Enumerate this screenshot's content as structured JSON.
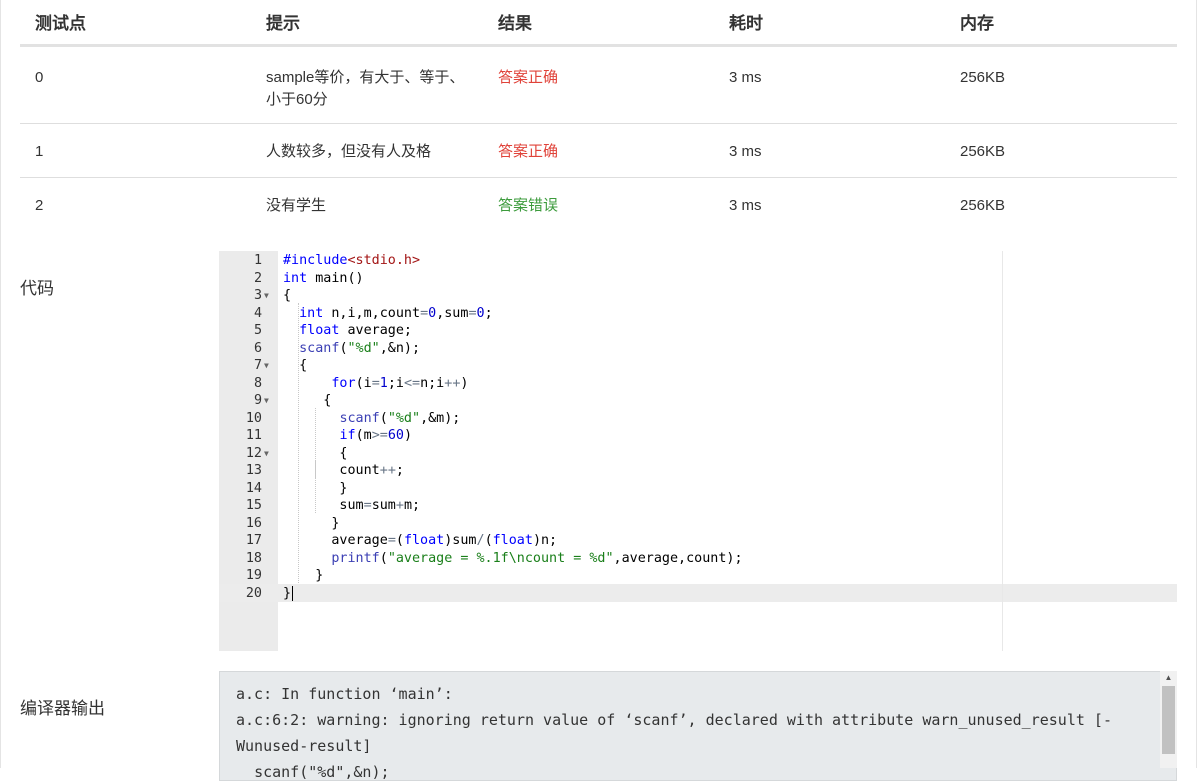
{
  "table": {
    "headers": {
      "case": "测试点",
      "hint": "提示",
      "result": "结果",
      "time": "耗时",
      "memory": "内存"
    },
    "rows": [
      {
        "case": "0",
        "hint": "sample等价，有大于、等于、小于60分",
        "result": "答案正确",
        "status": "correct",
        "time": "3 ms",
        "memory": "256KB"
      },
      {
        "case": "1",
        "hint": "人数较多，但没有人及格",
        "result": "答案正确",
        "status": "correct",
        "time": "3 ms",
        "memory": "256KB"
      },
      {
        "case": "2",
        "hint": "没有学生",
        "result": "答案错误",
        "status": "wrong",
        "time": "3 ms",
        "memory": "256KB"
      }
    ]
  },
  "code_section": {
    "label": "代码",
    "language": "c",
    "active_line": 20,
    "lines": [
      "#include<stdio.h>",
      "int main()",
      "{",
      "  int n,i,m,count=0,sum=0;",
      "  float average;",
      "  scanf(\"%d\",&n);",
      "  {",
      "      for(i=1;i<=n;i++)",
      "     {",
      "       scanf(\"%d\",&m);",
      "       if(m>=60)",
      "       {",
      "       count++;",
      "       }",
      "       sum=sum+m;",
      "      }",
      "      average=(float)sum/(float)n;",
      "      printf(\"average = %.1f\\ncount = %d\",average,count);",
      "    }",
      "}"
    ],
    "fold_lines": [
      3,
      7,
      9,
      12
    ]
  },
  "compiler_section": {
    "label": "编译器输出",
    "output_lines": [
      "a.c: In function ‘main’:",
      "a.c:6:2: warning: ignoring return value of ‘scanf’, declared with attribute warn_unused_result [-Wunused-result]",
      "  scanf(\"%d\",&n);"
    ]
  },
  "colors": {
    "correct": "#e0433a",
    "wrong": "#3c9b3c",
    "keyword": "#0000ff",
    "string": "#1a7f1a",
    "gutter_bg": "#ebebeb",
    "compiler_bg": "#e7eaec"
  },
  "icons": {
    "fold": "triangle-down-icon",
    "scroll_up": "scroll-up-arrow-icon"
  }
}
